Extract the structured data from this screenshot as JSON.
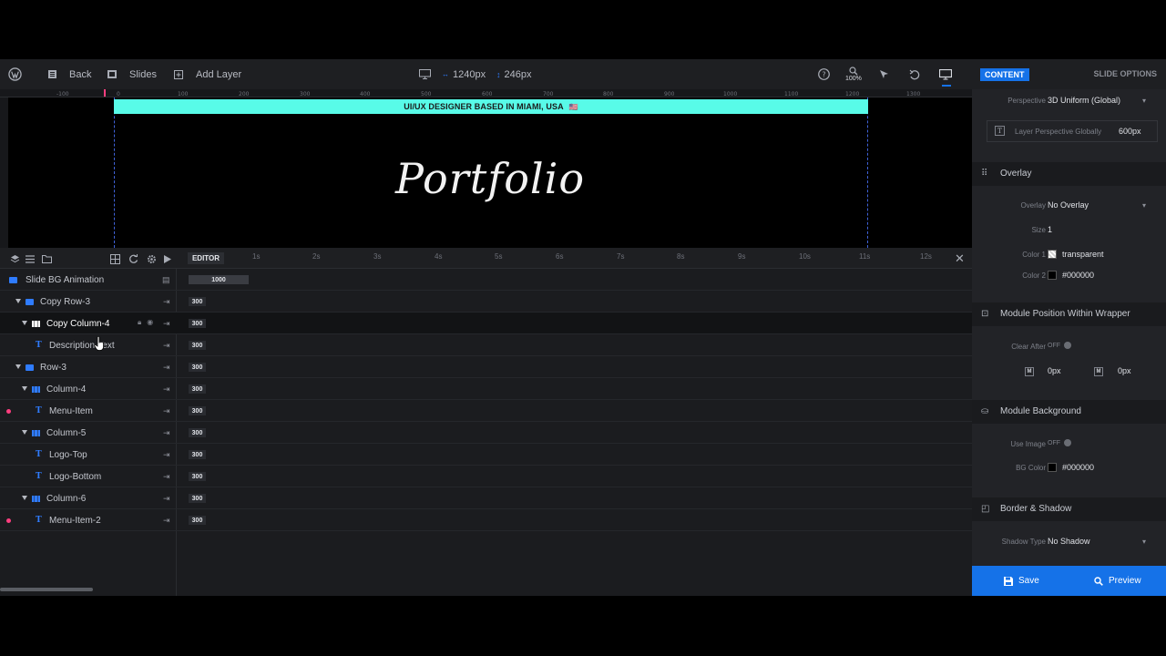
{
  "toolbar": {
    "back_label": "Back",
    "slides_label": "Slides",
    "add_layer_label": "Add Layer",
    "width_value": "1240px",
    "height_value": "246px",
    "zoom_value": "100%"
  },
  "ruler": {
    "ticks": [
      "-100",
      "0",
      "100",
      "200",
      "300",
      "400",
      "500",
      "600",
      "700",
      "800",
      "900",
      "1000",
      "1100",
      "1200",
      "1300"
    ]
  },
  "canvas": {
    "banner_text": "UI/UX DESIGNER BASED IN MIAMI, USA",
    "banner_flag": "🇺🇸",
    "headline": "Portfolio"
  },
  "timeline": {
    "editor_label": "EDITOR",
    "seconds": [
      "1s",
      "2s",
      "3s",
      "4s",
      "5s",
      "6s",
      "7s",
      "8s",
      "9s",
      "10s",
      "11s",
      "12s"
    ]
  },
  "layers": [
    {
      "label": "Slide BG Animation",
      "duration": "1000"
    },
    {
      "label": "Copy Row-3",
      "duration": "300"
    },
    {
      "label": "Copy Column-4",
      "duration": "300"
    },
    {
      "label": "Description-Text",
      "duration": "300"
    },
    {
      "label": "Row-3",
      "duration": "300"
    },
    {
      "label": "Column-4",
      "duration": "300"
    },
    {
      "label": "Menu-Item",
      "duration": "300"
    },
    {
      "label": "Column-5",
      "duration": "300"
    },
    {
      "label": "Logo-Top",
      "duration": "300"
    },
    {
      "label": "Logo-Bottom",
      "duration": "300"
    },
    {
      "label": "Column-6",
      "duration": "300"
    },
    {
      "label": "Menu-Item-2",
      "duration": "300"
    }
  ],
  "panel": {
    "tab_content": "CONTENT",
    "tab_slide_options": "SLIDE OPTIONS",
    "perspective_label": "Perspective",
    "perspective_value": "3D Uniform (Global)",
    "layer_perspective_label": "Layer Perspective Globally",
    "layer_perspective_value": "600px",
    "overlay_section": "Overlay",
    "overlay_label": "Overlay",
    "overlay_value": "No Overlay",
    "size_label": "Size",
    "size_value": "1",
    "color1_label": "Color 1",
    "color1_value": "transparent",
    "color2_label": "Color 2",
    "color2_value": "#000000",
    "module_position_section": "Module Position Within Wrapper",
    "clear_after_label": "Clear After",
    "clear_after_value": "OFF",
    "margin_left_value": "0px",
    "margin_right_value": "0px",
    "margin_icon": "M",
    "module_bg_section": "Module Background",
    "use_image_label": "Use Image",
    "use_image_value": "OFF",
    "bg_color_label": "BG Color",
    "bg_color_value": "#000000",
    "border_shadow_section": "Border & Shadow",
    "shadow_type_label": "Shadow Type",
    "shadow_type_value": "No Shadow",
    "save_label": "Save",
    "preview_label": "Preview"
  },
  "colors": {
    "accent": "#1572e8",
    "banner": "#58fbe8",
    "marker": "#ff3e7f"
  }
}
